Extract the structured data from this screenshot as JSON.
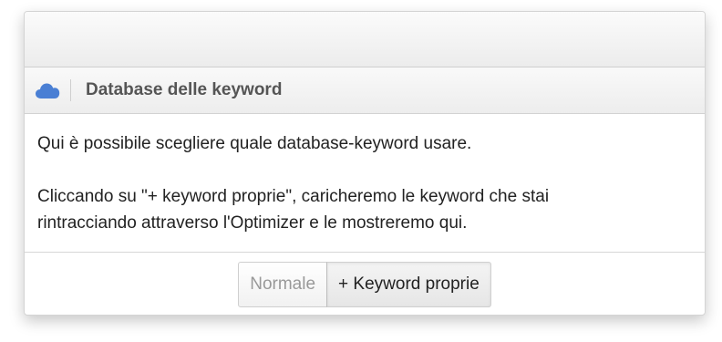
{
  "header": {
    "icon": "cloud-icon",
    "icon_color": "#4a7fd4",
    "title": "Database delle keyword"
  },
  "body": {
    "paragraph1": "Qui è possibile scegliere quale database-keyword usare.",
    "paragraph2_line1": "Cliccando su \"+ keyword proprie\", caricheremo le keyword che stai",
    "paragraph2_line2": "rintracciando attraverso l'Optimizer e le mostreremo qui."
  },
  "footer": {
    "options": [
      {
        "label": "Normale",
        "selected": false
      },
      {
        "label": "+ Keyword proprie",
        "selected": true
      }
    ]
  }
}
